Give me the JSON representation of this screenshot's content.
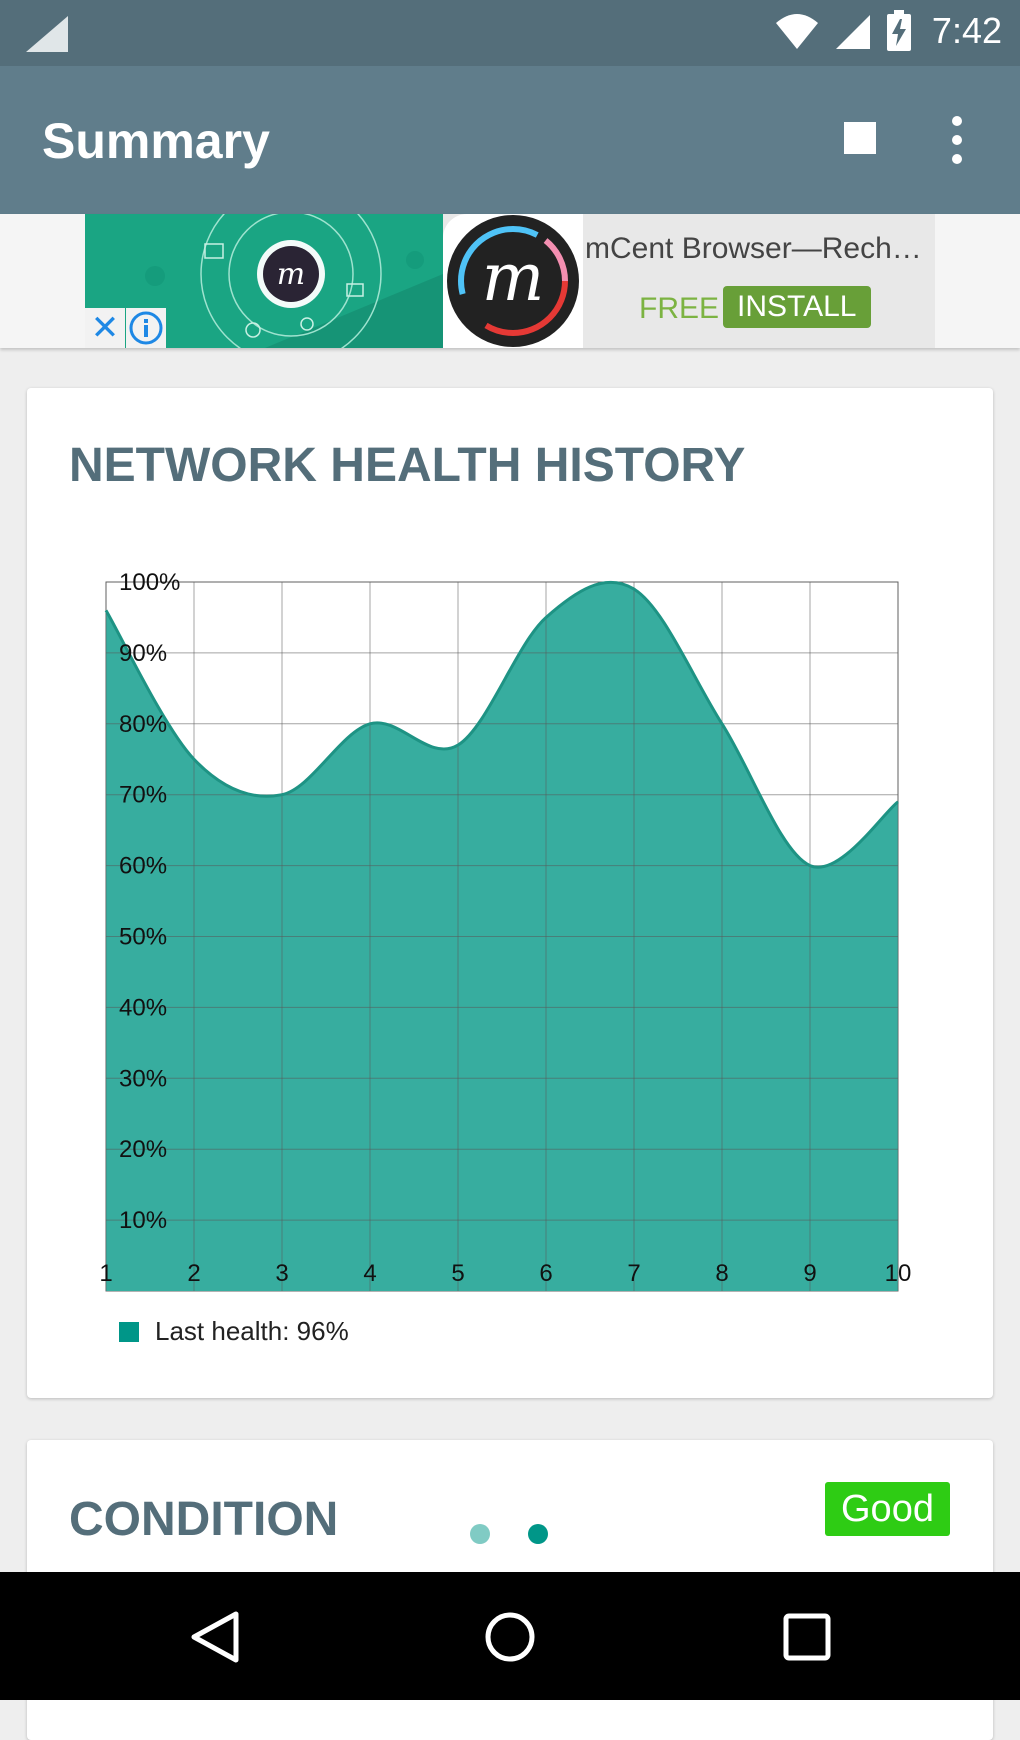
{
  "status_bar": {
    "time": "7:42",
    "icons": [
      "signal-icon",
      "wifi-icon",
      "cell-signal-icon",
      "battery-charging-icon"
    ]
  },
  "app_bar": {
    "title": "Summary",
    "actions": [
      "stop-icon",
      "more-vert-icon"
    ]
  },
  "ad": {
    "title": "mCent Browser—Rech…",
    "free_label": "FREE",
    "install_label": "INSTALL",
    "close_icon": "close-icon",
    "info_icon": "info-icon",
    "logo_letter": "m"
  },
  "chart_card": {
    "title": "NETWORK HEALTH HISTORY",
    "legend_label": "Last health: 96%"
  },
  "condition_card": {
    "title": "CONDITION",
    "badge": "Good"
  },
  "pager": {
    "dots": 2,
    "active_index": 1
  },
  "nav_bar": {
    "icons": [
      "back-icon",
      "home-icon",
      "recents-icon"
    ]
  },
  "colors": {
    "status_bar": "#546e7a",
    "app_bar": "#607d8b",
    "chart_fill": "#37ad9f",
    "chart_line": "#1e9384",
    "legend": "#009688",
    "badge": "#2ecc14",
    "title_text": "#546e7a"
  },
  "chart_data": {
    "type": "area",
    "x": [
      1,
      2,
      3,
      4,
      5,
      6,
      7,
      8,
      9,
      10
    ],
    "series": [
      {
        "name": "Last health: 96%",
        "values": [
          96,
          75,
          70,
          80,
          77,
          95,
          99,
          80,
          60,
          69
        ]
      }
    ],
    "xlim": [
      1,
      10
    ],
    "ylim": [
      0,
      100
    ],
    "yticks": [
      10,
      20,
      30,
      40,
      50,
      60,
      70,
      80,
      90,
      100
    ],
    "ytick_labels": [
      "10%",
      "20%",
      "30%",
      "40%",
      "50%",
      "60%",
      "70%",
      "80%",
      "90%",
      "100%"
    ],
    "xtick_labels": [
      "1",
      "2",
      "3",
      "4",
      "5",
      "6",
      "7",
      "8",
      "9",
      "10"
    ],
    "grid": true,
    "legend_position": "bottom-left"
  }
}
